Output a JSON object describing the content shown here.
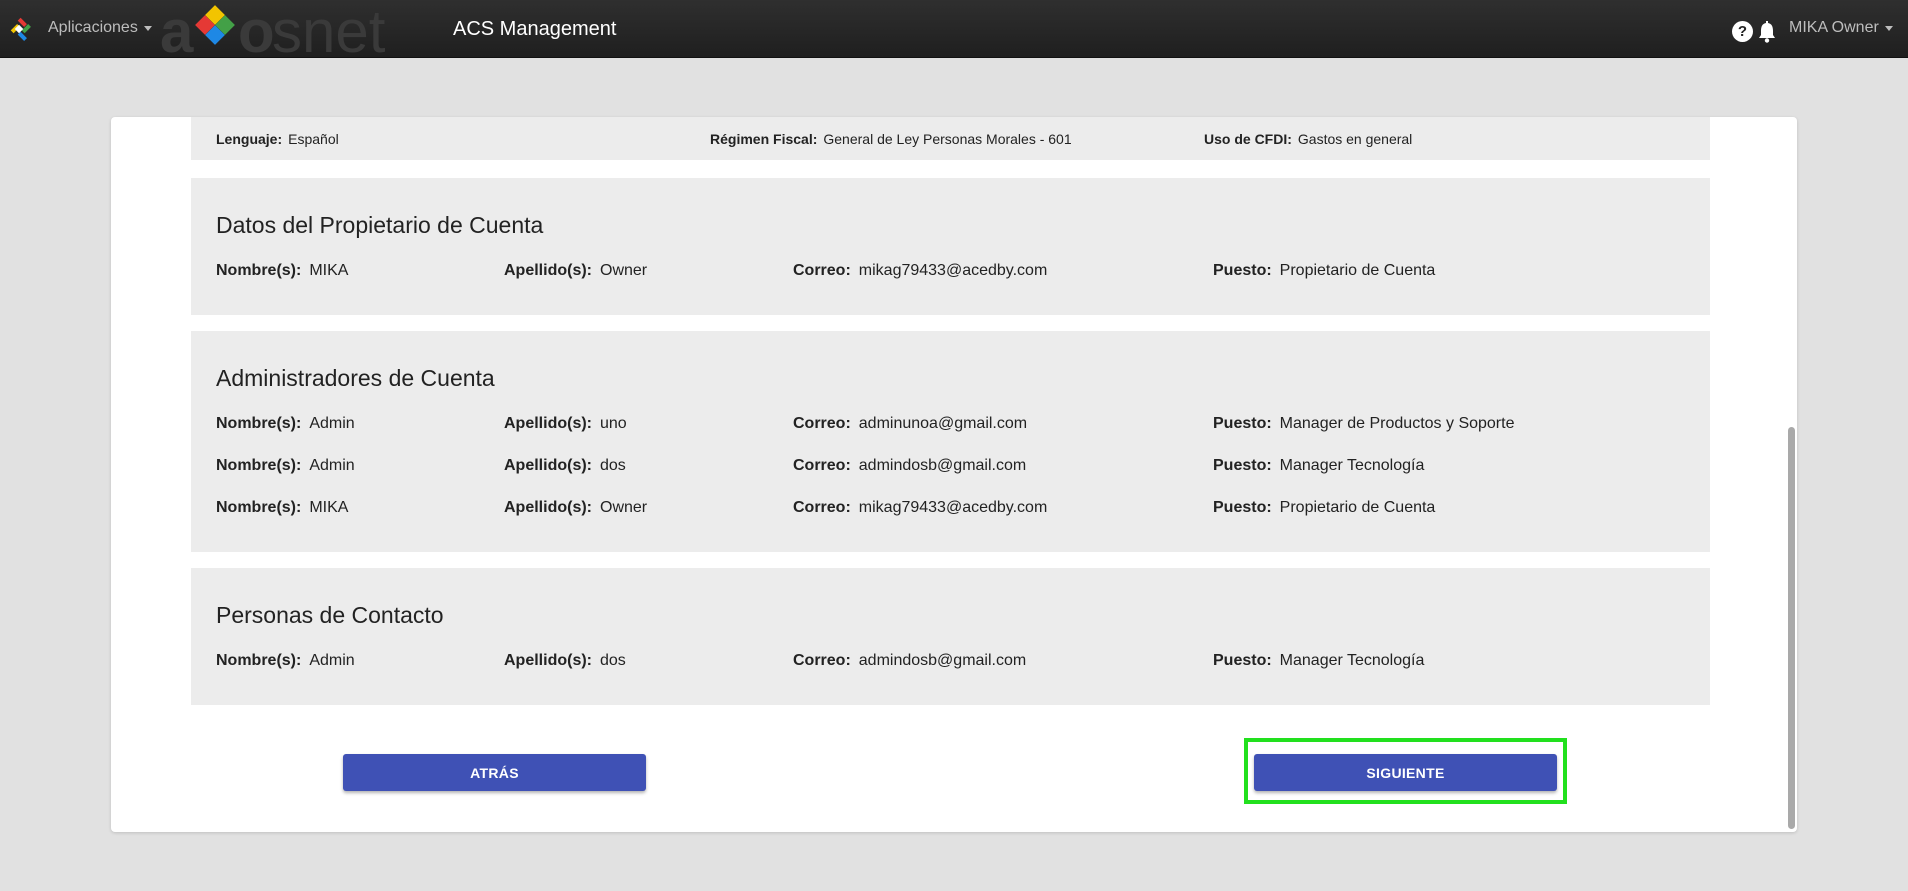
{
  "topbar": {
    "apps_label": "Aplicaciones",
    "logo_text": "axosnet",
    "title": "ACS Management",
    "help_glyph": "?",
    "user_label": "MIKA Owner"
  },
  "top_summary": {
    "fields": [
      {
        "label": "Lenguaje:",
        "value": "Español"
      },
      {
        "label": "Régimen Fiscal:",
        "value": "General de Ley Personas Morales - 601"
      },
      {
        "label": "Uso de CFDI:",
        "value": "Gastos en general"
      }
    ]
  },
  "labels": {
    "name": "Nombre(s):",
    "last": "Apellido(s):",
    "mail": "Correo:",
    "post": "Puesto:"
  },
  "owner": {
    "title": "Datos del Propietario de Cuenta",
    "rows": [
      {
        "name": "MIKA",
        "last": "Owner",
        "mail": "mikag79433@acedby.com",
        "post": "Propietario de Cuenta"
      }
    ]
  },
  "admins": {
    "title": "Administradores de Cuenta",
    "rows": [
      {
        "name": "Admin",
        "last": "uno",
        "mail": "adminunoa@gmail.com",
        "post": "Manager de Productos y Soporte"
      },
      {
        "name": "Admin",
        "last": "dos",
        "mail": "admindosb@gmail.com",
        "post": "Manager Tecnología"
      },
      {
        "name": "MIKA",
        "last": "Owner",
        "mail": "mikag79433@acedby.com",
        "post": "Propietario de Cuenta"
      }
    ]
  },
  "contacts": {
    "title": "Personas de Contacto",
    "rows": [
      {
        "name": "Admin",
        "last": "dos",
        "mail": "admindosb@gmail.com",
        "post": "Manager Tecnología"
      }
    ]
  },
  "buttons": {
    "back": "ATRÁS",
    "next": "SIGUIENTE"
  },
  "colors": {
    "accent": "#3f51b5",
    "highlight": "#22e01e",
    "topbar": "#262626"
  }
}
